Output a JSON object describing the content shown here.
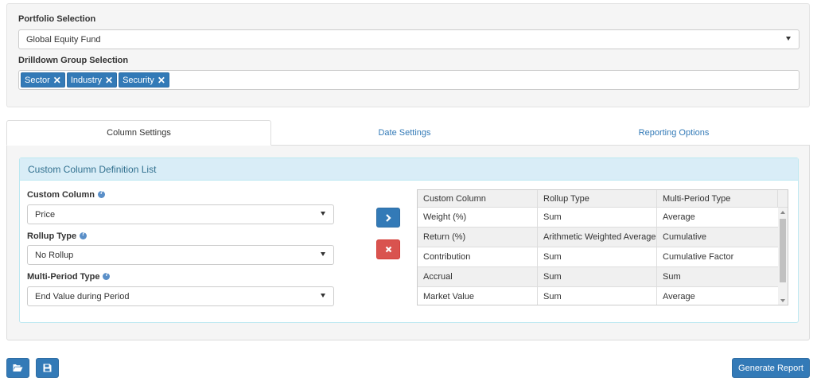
{
  "portfolio": {
    "label": "Portfolio Selection",
    "selected": "Global Equity Fund"
  },
  "drilldown": {
    "label": "Drilldown Group Selection",
    "tags": [
      "Sector",
      "Industry",
      "Security"
    ],
    "remove_glyph": "✕"
  },
  "tabs": [
    "Column Settings",
    "Date Settings",
    "Reporting Options"
  ],
  "custom_columns": {
    "heading": "Custom Column Definition List",
    "custom_column_label": "Custom Column",
    "custom_column_value": "Price",
    "rollup_label": "Rollup Type",
    "rollup_value": "No Rollup",
    "multi_period_label": "Multi-Period Type",
    "multi_period_value": "End Value during Period"
  },
  "grid": {
    "columns": [
      "Custom Column",
      "Rollup Type",
      "Multi-Period Type"
    ],
    "rows": [
      [
        "Weight (%)",
        "Sum",
        "Average"
      ],
      [
        "Return (%)",
        "Arithmetic Weighted Average",
        "Cumulative"
      ],
      [
        "Contribution",
        "Sum",
        "Cumulative Factor"
      ],
      [
        "Accrual",
        "Sum",
        "Sum"
      ],
      [
        "Market Value",
        "Sum",
        "Average"
      ]
    ]
  },
  "buttons": {
    "generate_report": "Generate Report"
  },
  "icons": {
    "add": "chevron-right-icon",
    "remove": "close-icon",
    "open": "folder-open-icon",
    "save": "save-icon",
    "help": "question-circle-icon"
  },
  "colors": {
    "primary": "#337ab7",
    "danger": "#d9534f",
    "info_bg": "#d9edf7",
    "info_text": "#31708f"
  }
}
